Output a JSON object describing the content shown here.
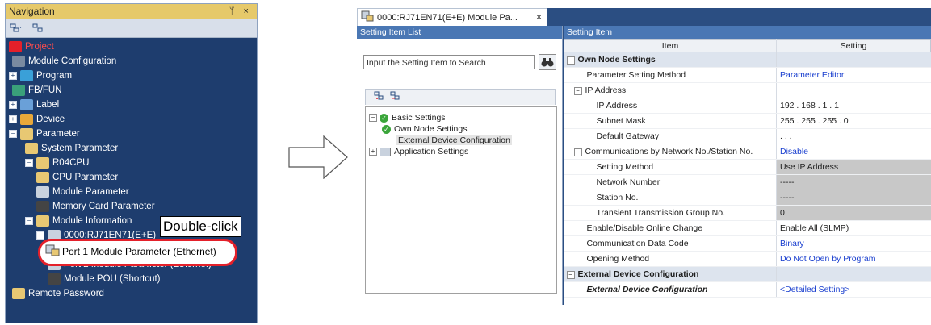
{
  "navigation": {
    "title": "Navigation",
    "title_controls": "ᛘ ×",
    "tree": [
      {
        "label": "Project",
        "icon": "project-icon",
        "type": "project"
      },
      {
        "label": "Module Configuration",
        "icon": "module-config-icon"
      },
      {
        "label": "Program",
        "icon": "program-icon",
        "expander": "+"
      },
      {
        "label": "FB/FUN",
        "icon": "fbfun-icon"
      },
      {
        "label": "Label",
        "icon": "label-icon",
        "expander": "+"
      },
      {
        "label": "Device",
        "icon": "device-icon",
        "expander": "+"
      },
      {
        "label": "Parameter",
        "icon": "parameter-icon",
        "expander": "−"
      },
      {
        "label": "System Parameter",
        "icon": "system-parameter-icon"
      },
      {
        "label": "R04CPU",
        "icon": "cpu-icon",
        "expander": "−"
      },
      {
        "label": "CPU Parameter",
        "icon": "cpu-parameter-icon"
      },
      {
        "label": "Module Parameter",
        "icon": "module-parameter-icon"
      },
      {
        "label": "Memory Card Parameter",
        "icon": "memory-card-icon"
      },
      {
        "label": "Module Information",
        "icon": "module-info-icon",
        "expander": "−"
      },
      {
        "label": "0000:RJ71EN71(E+E)",
        "icon": "module-icon",
        "expander": "−"
      },
      {
        "label": "Port 1 Module Parameter (Ethernet)",
        "icon": "network-module-icon",
        "selected": true
      },
      {
        "label": "Port 2 Module Parameter (Ethernet)",
        "icon": "network-module-icon"
      },
      {
        "label": "Module POU (Shortcut)",
        "icon": "pou-icon"
      },
      {
        "label": "Remote Password",
        "icon": "remote-password-icon"
      }
    ],
    "callout": "Double-click",
    "highlight": "Port 1 Module Parameter (Ethernet)"
  },
  "window": {
    "tab_label": "0000:RJ71EN71(E+E) Module Pa...",
    "tab_close": "×",
    "left_header": "Setting Item List",
    "search_placeholder": "Input the Setting Item to Search",
    "left_tree": [
      {
        "label": "Basic Settings",
        "expander": "−",
        "check": true
      },
      {
        "label": "Own Node Settings",
        "check": true
      },
      {
        "label": "External Device Configuration",
        "selected": true
      },
      {
        "label": "Application Settings",
        "expander": "+"
      }
    ],
    "right_header": "Setting Item",
    "grid_headers": {
      "item": "Item",
      "setting": "Setting"
    },
    "rows": [
      {
        "item": "Own Node Settings",
        "group": true,
        "expander": "−"
      },
      {
        "item": "Parameter Setting Method",
        "value": "Parameter Editor",
        "blue": true
      },
      {
        "item": "IP Address",
        "subgroup": true,
        "expander": "−"
      },
      {
        "item": "IP Address",
        "value": "192 . 168 .  1 .  1",
        "level": 2
      },
      {
        "item": "Subnet Mask",
        "value": "255 . 255 . 255 .  0",
        "level": 2
      },
      {
        "item": "Default Gateway",
        "value": ". . .",
        "level": 2
      },
      {
        "item": "Communications by Network No./Station No.",
        "value": "Disable",
        "blue": true,
        "subgroup": true,
        "expander": "−"
      },
      {
        "item": "Setting Method",
        "value": "Use IP Address",
        "gray": true,
        "level": 2
      },
      {
        "item": "Network Number",
        "value": "-----",
        "gray": true,
        "level": 2
      },
      {
        "item": "Station No.",
        "value": "-----",
        "gray": true,
        "level": 2
      },
      {
        "item": "Transient Transmission Group No.",
        "value": "0",
        "gray": true,
        "level": 2
      },
      {
        "item": "Enable/Disable Online Change",
        "value": "Enable All (SLMP)"
      },
      {
        "item": "Communication Data Code",
        "value": "Binary",
        "blue": true
      },
      {
        "item": "Opening Method",
        "value": "Do Not Open by Program",
        "blue": true
      },
      {
        "item": "External Device Configuration",
        "group": true,
        "expander": "−"
      },
      {
        "item": "External Device Configuration",
        "value": "<Detailed Setting>",
        "blue": true,
        "italic": true
      }
    ]
  }
}
